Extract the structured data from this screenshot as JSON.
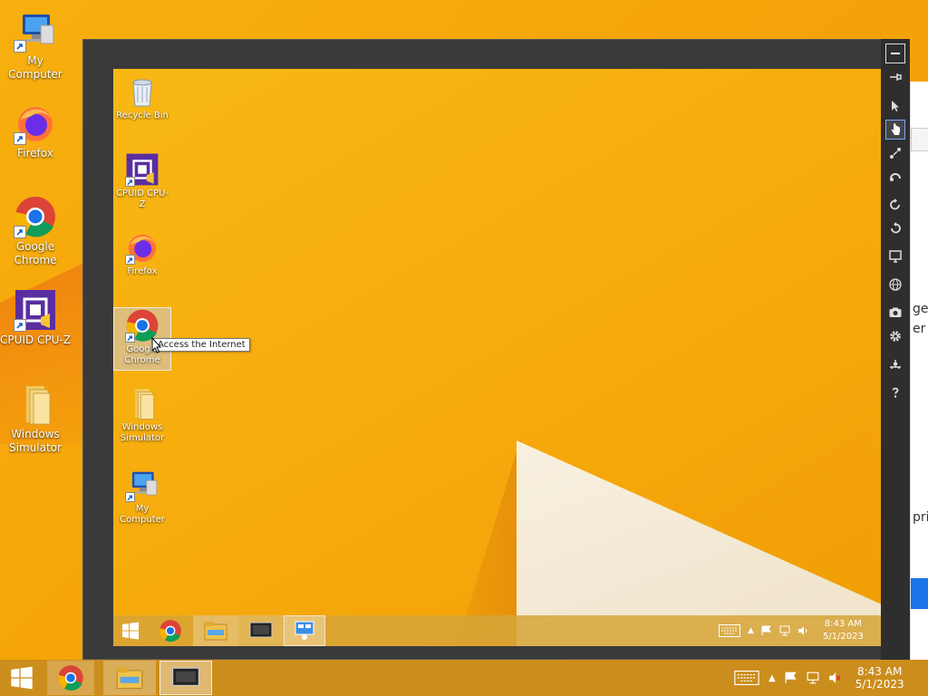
{
  "desktop": {
    "icons": [
      {
        "label": "My Computer"
      },
      {
        "label": "Firefox"
      },
      {
        "label": "Google Chrome"
      },
      {
        "label": "CPUID CPU-Z"
      },
      {
        "label": "Windows Simulator"
      }
    ]
  },
  "simulator": {
    "icons": [
      {
        "label": "Recycle Bin"
      },
      {
        "label": "CPUID CPU-Z"
      },
      {
        "label": "Firefox"
      },
      {
        "label": "Google Chrome"
      },
      {
        "label": "Windows Simulator"
      },
      {
        "label": "My Computer"
      }
    ],
    "tooltip": "Access the Internet",
    "clock": {
      "time": "8:43 AM",
      "date": "5/1/2023"
    }
  },
  "host_taskbar": {
    "clock": {
      "time": "8:43 AM",
      "date": "5/1/2023"
    }
  },
  "background_window": {
    "fragments": [
      "get",
      "er s",
      "pri"
    ]
  },
  "colors": {
    "accent": "#f5a80c",
    "chrome_blue": "#1a73e8"
  }
}
